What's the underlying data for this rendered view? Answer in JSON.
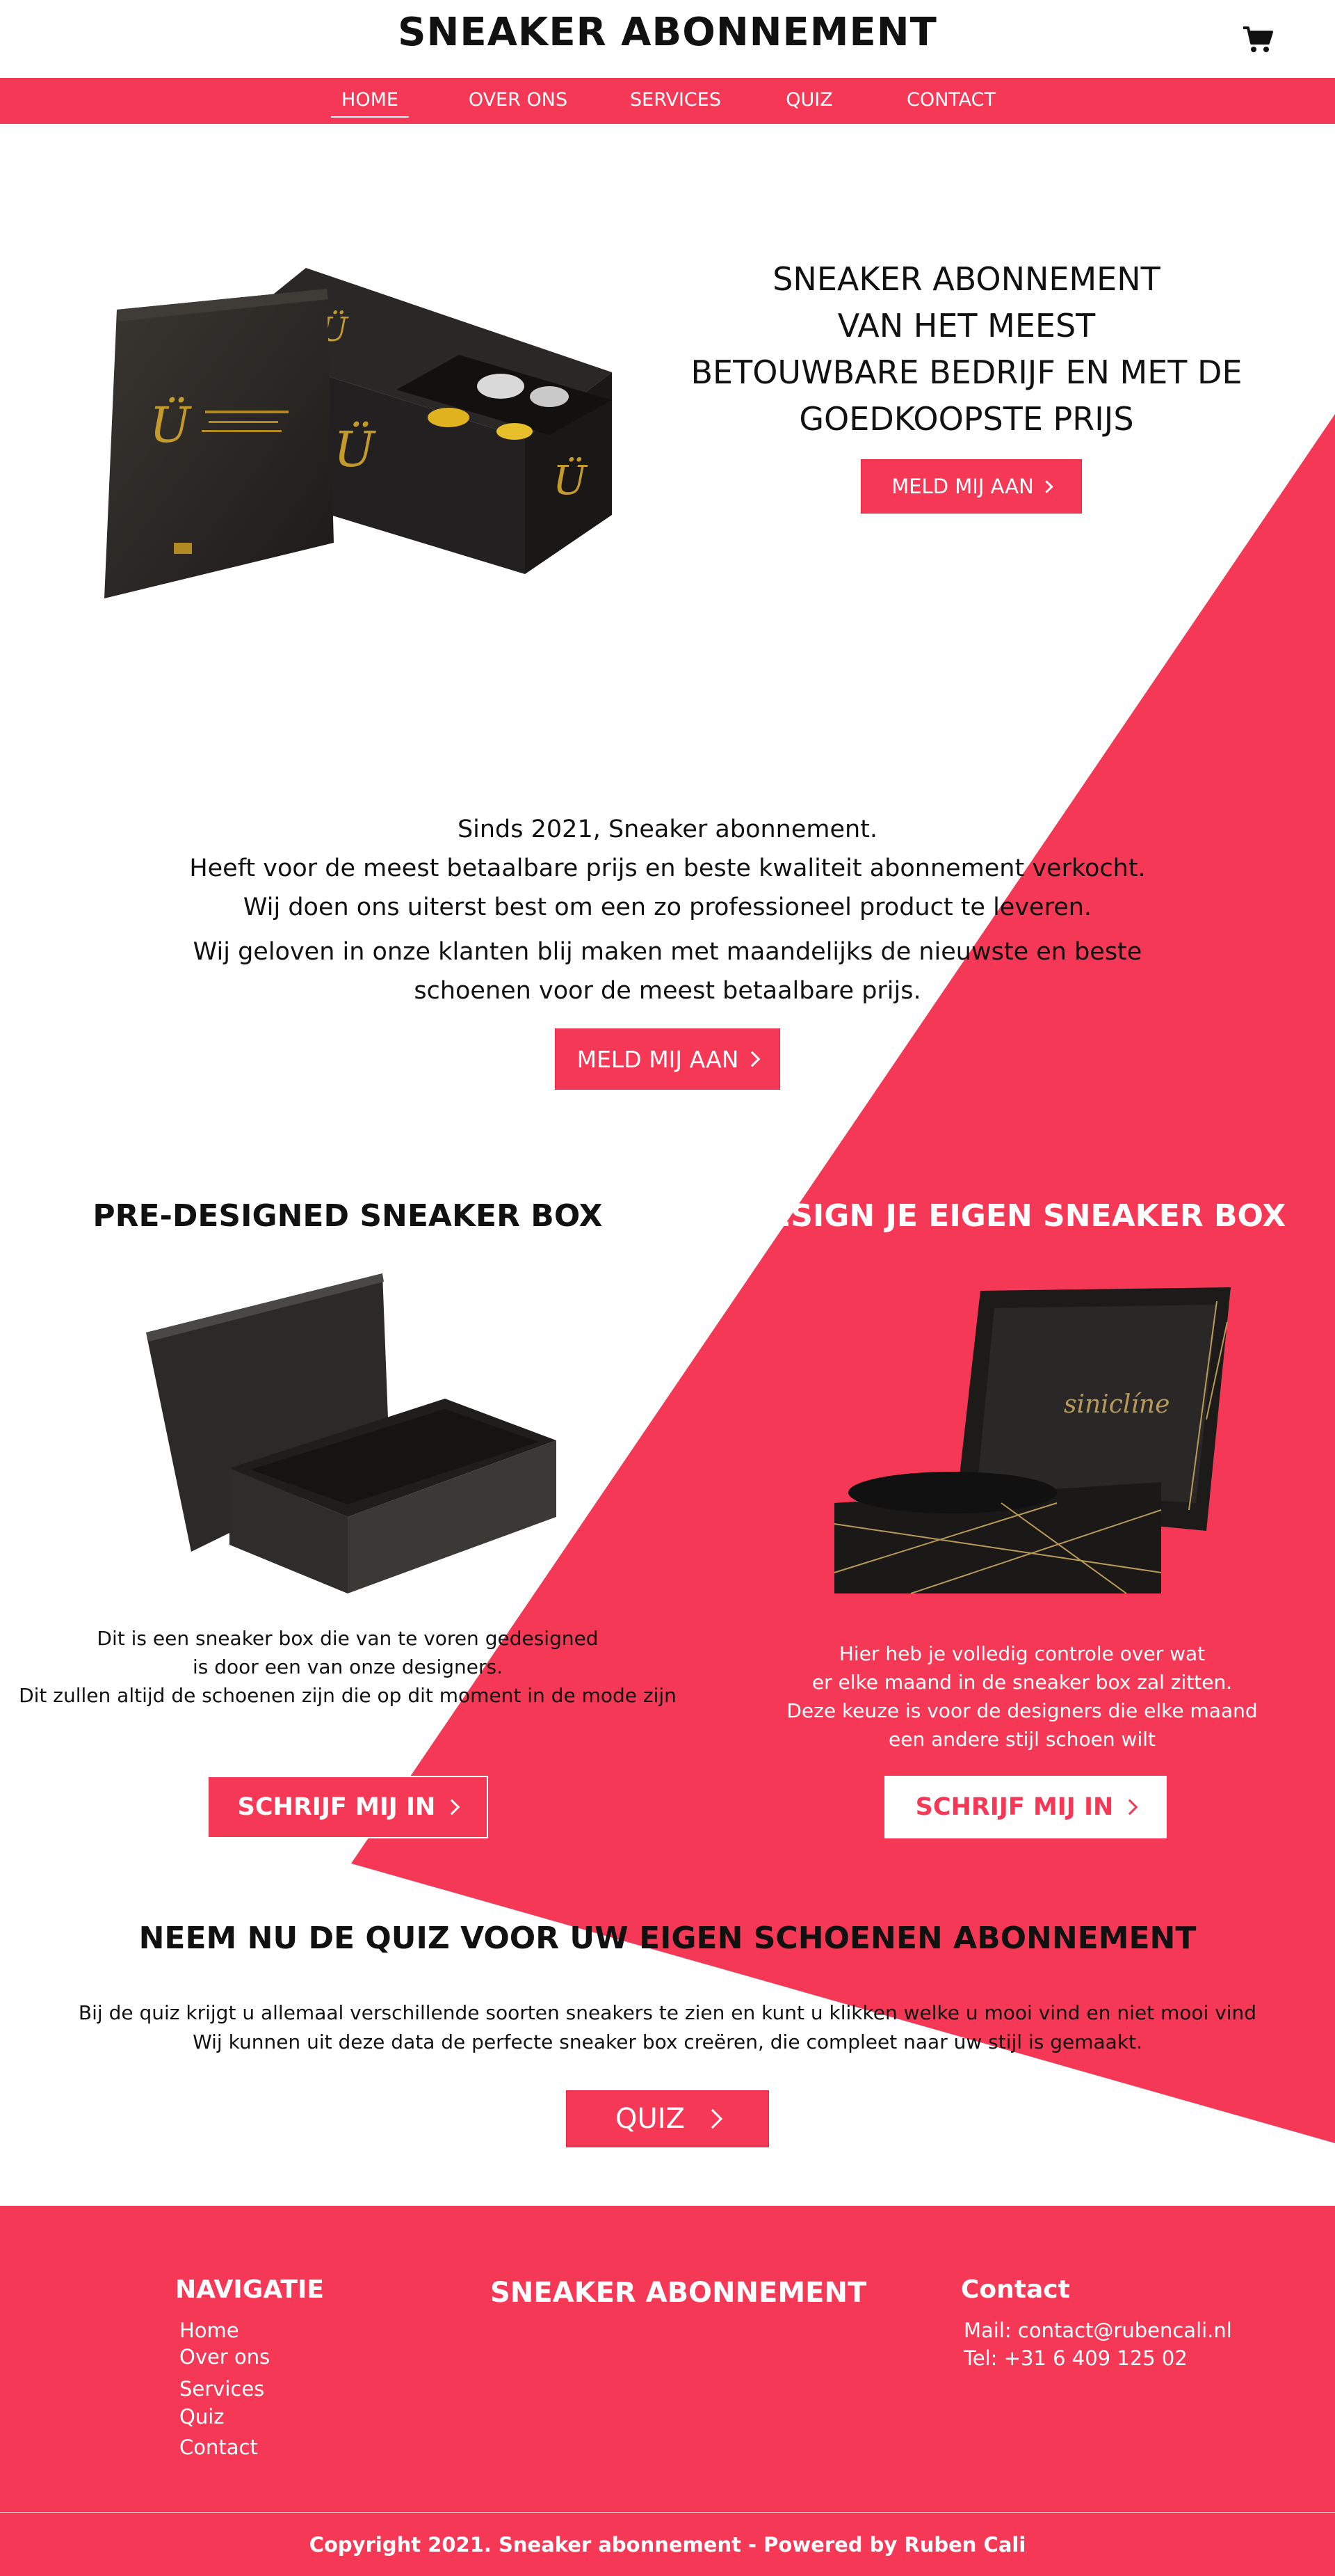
{
  "header": {
    "brand": "SNEAKER ABONNEMENT",
    "cart_icon": "shopping-cart-icon"
  },
  "nav": {
    "items": [
      {
        "label": "HOME",
        "active": true
      },
      {
        "label": "OVER ONS",
        "active": false
      },
      {
        "label": "SERVICES",
        "active": false
      },
      {
        "label": "QUIZ",
        "active": false
      },
      {
        "label": "CONTACT",
        "active": false
      }
    ]
  },
  "colors": {
    "accent": "#f53855",
    "text": "#111111",
    "white": "#ffffff"
  },
  "hero": {
    "title_lines": [
      "SNEAKER ABONNEMENT",
      "VAN HET MEEST",
      "BETOUWBARE BEDRIJF EN MET DE",
      "GOEDKOOPSTE PRIJS"
    ],
    "button": "MELD MIJ AAN",
    "image": "black-luxury-box-image"
  },
  "about": {
    "lines": [
      "Sinds 2021, Sneaker abonnement.",
      "Heeft voor de meest betaalbare prijs en beste kwaliteit abonnement verkocht.",
      "Wij doen ons uiterst best om een zo professioneel product te leveren.",
      "Wij geloven in onze klanten blij maken met maandelijks de nieuwste en beste",
      "schoenen voor de meest betaalbare prijs."
    ],
    "button": "MELD MIJ AAN"
  },
  "predesigned": {
    "title": "PRE-DESIGNED SNEAKER BOX",
    "text_lines": [
      "Dit is een sneaker box die van te voren gedesigned",
      "is door een van onze designers.",
      "Dit zullen altijd de schoenen zijn die op dit moment in de mode zijn"
    ],
    "button": "SCHRIJF MIJ IN"
  },
  "custom": {
    "title": "DESIGN JE EIGEN SNEAKER BOX",
    "box_brand": "siniclíne",
    "text_lines": [
      "Hier heb je volledig controle over wat",
      "er elke maand in de sneaker box zal zitten.",
      "Deze keuze is voor de designers die elke maand",
      "een andere stijl schoen wilt"
    ],
    "button": "SCHRIJF MIJ IN"
  },
  "quiz": {
    "title": "NEEM NU DE QUIZ VOOR UW EIGEN SCHOENEN ABONNEMENT",
    "text_lines": [
      "Bij de quiz krijgt u allemaal verschillende soorten sneakers te zien en kunt u klikken welke u mooi vind en niet mooi vind",
      "Wij kunnen uit deze data de perfecte sneaker box creëren, die compleet naar uw stijl is gemaakt."
    ],
    "button": "QUIZ"
  },
  "footer": {
    "nav_title": "NAVIGATIE",
    "nav_links": [
      "Home",
      "Over ons",
      "Services",
      "Quiz",
      "Contact"
    ],
    "brand": "SNEAKER ABONNEMENT",
    "contact_title": "Contact",
    "mail": "Mail: contact@rubencali.nl",
    "tel": "Tel: +31 6 409 125 02",
    "copyright": "Copyright 2021. Sneaker abonnement - Powered by Ruben Cali"
  }
}
